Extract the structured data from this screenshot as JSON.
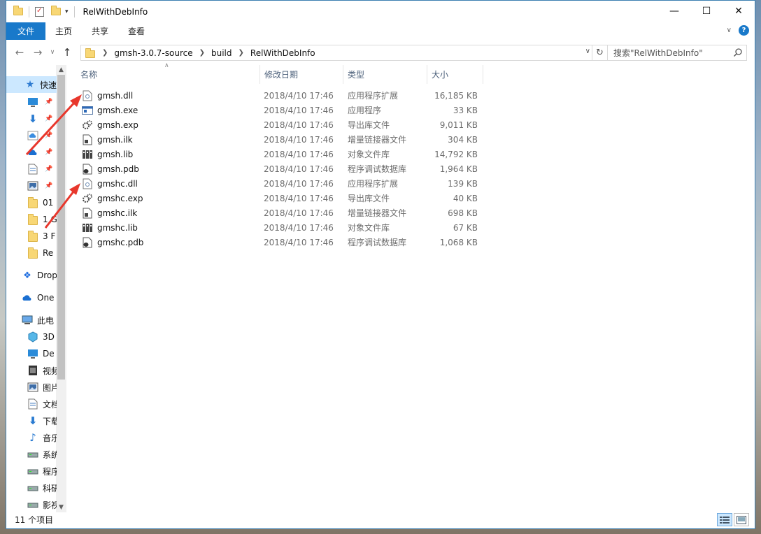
{
  "window": {
    "title": "RelWithDebInfo"
  },
  "ribbon": {
    "tabs": [
      "文件",
      "主页",
      "共享",
      "查看"
    ]
  },
  "address": {
    "crumbs": [
      "gmsh-3.0.7-source",
      "build",
      "RelWithDebInfo"
    ]
  },
  "search": {
    "placeholder": "搜索\"RelWithDebInfo\""
  },
  "navpane": {
    "items": [
      {
        "label": "快速",
        "icon": "star-icon"
      },
      {
        "label": "",
        "icon": "desktop-icon"
      },
      {
        "label": "",
        "icon": "download-icon"
      },
      {
        "label": "",
        "icon": "cloud-icon"
      },
      {
        "label": "",
        "icon": "onedrive-icon"
      },
      {
        "label": "",
        "icon": "document-icon"
      },
      {
        "label": "",
        "icon": "picture-icon"
      },
      {
        "label": "01",
        "icon": "folder-icon"
      },
      {
        "label": "1 G",
        "icon": "folder-icon"
      },
      {
        "label": "3 F",
        "icon": "folder-icon"
      },
      {
        "label": "Re",
        "icon": "folder-icon"
      },
      {
        "label": "Drop",
        "icon": "dropbox-icon"
      },
      {
        "label": "One",
        "icon": "onedrive-icon"
      },
      {
        "label": "此电",
        "icon": "computer-icon"
      },
      {
        "label": "3D",
        "icon": "3d-objects-icon"
      },
      {
        "label": "De",
        "icon": "desktop-icon"
      },
      {
        "label": "视频",
        "icon": "video-icon"
      },
      {
        "label": "图片",
        "icon": "picture-icon"
      },
      {
        "label": "文档",
        "icon": "document-icon"
      },
      {
        "label": "下载",
        "icon": "download-icon"
      },
      {
        "label": "音乐",
        "icon": "music-icon"
      },
      {
        "label": "系统",
        "icon": "drive-icon"
      },
      {
        "label": "程序",
        "icon": "drive-icon"
      },
      {
        "label": "科研",
        "icon": "drive-icon"
      },
      {
        "label": "影视",
        "icon": "drive-icon"
      }
    ]
  },
  "columns": [
    "名称",
    "修改日期",
    "类型",
    "大小"
  ],
  "files": [
    {
      "name": "gmsh.dll",
      "date": "2018/4/10 17:46",
      "type": "应用程序扩展",
      "size": "16,185 KB",
      "icon": "dll"
    },
    {
      "name": "gmsh.exe",
      "date": "2018/4/10 17:46",
      "type": "应用程序",
      "size": "33 KB",
      "icon": "exe"
    },
    {
      "name": "gmsh.exp",
      "date": "2018/4/10 17:46",
      "type": "导出库文件",
      "size": "9,011 KB",
      "icon": "exp"
    },
    {
      "name": "gmsh.ilk",
      "date": "2018/4/10 17:46",
      "type": "增量链接器文件",
      "size": "304 KB",
      "icon": "ilk"
    },
    {
      "name": "gmsh.lib",
      "date": "2018/4/10 17:46",
      "type": "对象文件库",
      "size": "14,792 KB",
      "icon": "lib"
    },
    {
      "name": "gmsh.pdb",
      "date": "2018/4/10 17:46",
      "type": "程序调试数据库",
      "size": "1,964 KB",
      "icon": "pdb"
    },
    {
      "name": "gmshc.dll",
      "date": "2018/4/10 17:46",
      "type": "应用程序扩展",
      "size": "139 KB",
      "icon": "dll"
    },
    {
      "name": "gmshc.exp",
      "date": "2018/4/10 17:46",
      "type": "导出库文件",
      "size": "40 KB",
      "icon": "exp"
    },
    {
      "name": "gmshc.ilk",
      "date": "2018/4/10 17:46",
      "type": "增量链接器文件",
      "size": "698 KB",
      "icon": "ilk"
    },
    {
      "name": "gmshc.lib",
      "date": "2018/4/10 17:46",
      "type": "对象文件库",
      "size": "67 KB",
      "icon": "lib"
    },
    {
      "name": "gmshc.pdb",
      "date": "2018/4/10 17:46",
      "type": "程序调试数据库",
      "size": "1,068 KB",
      "icon": "pdb"
    }
  ],
  "status": {
    "count": "11 个项目"
  },
  "colors": {
    "accent": "#1979ca",
    "selection": "#cce8ff",
    "arrow": "#e8372c"
  }
}
